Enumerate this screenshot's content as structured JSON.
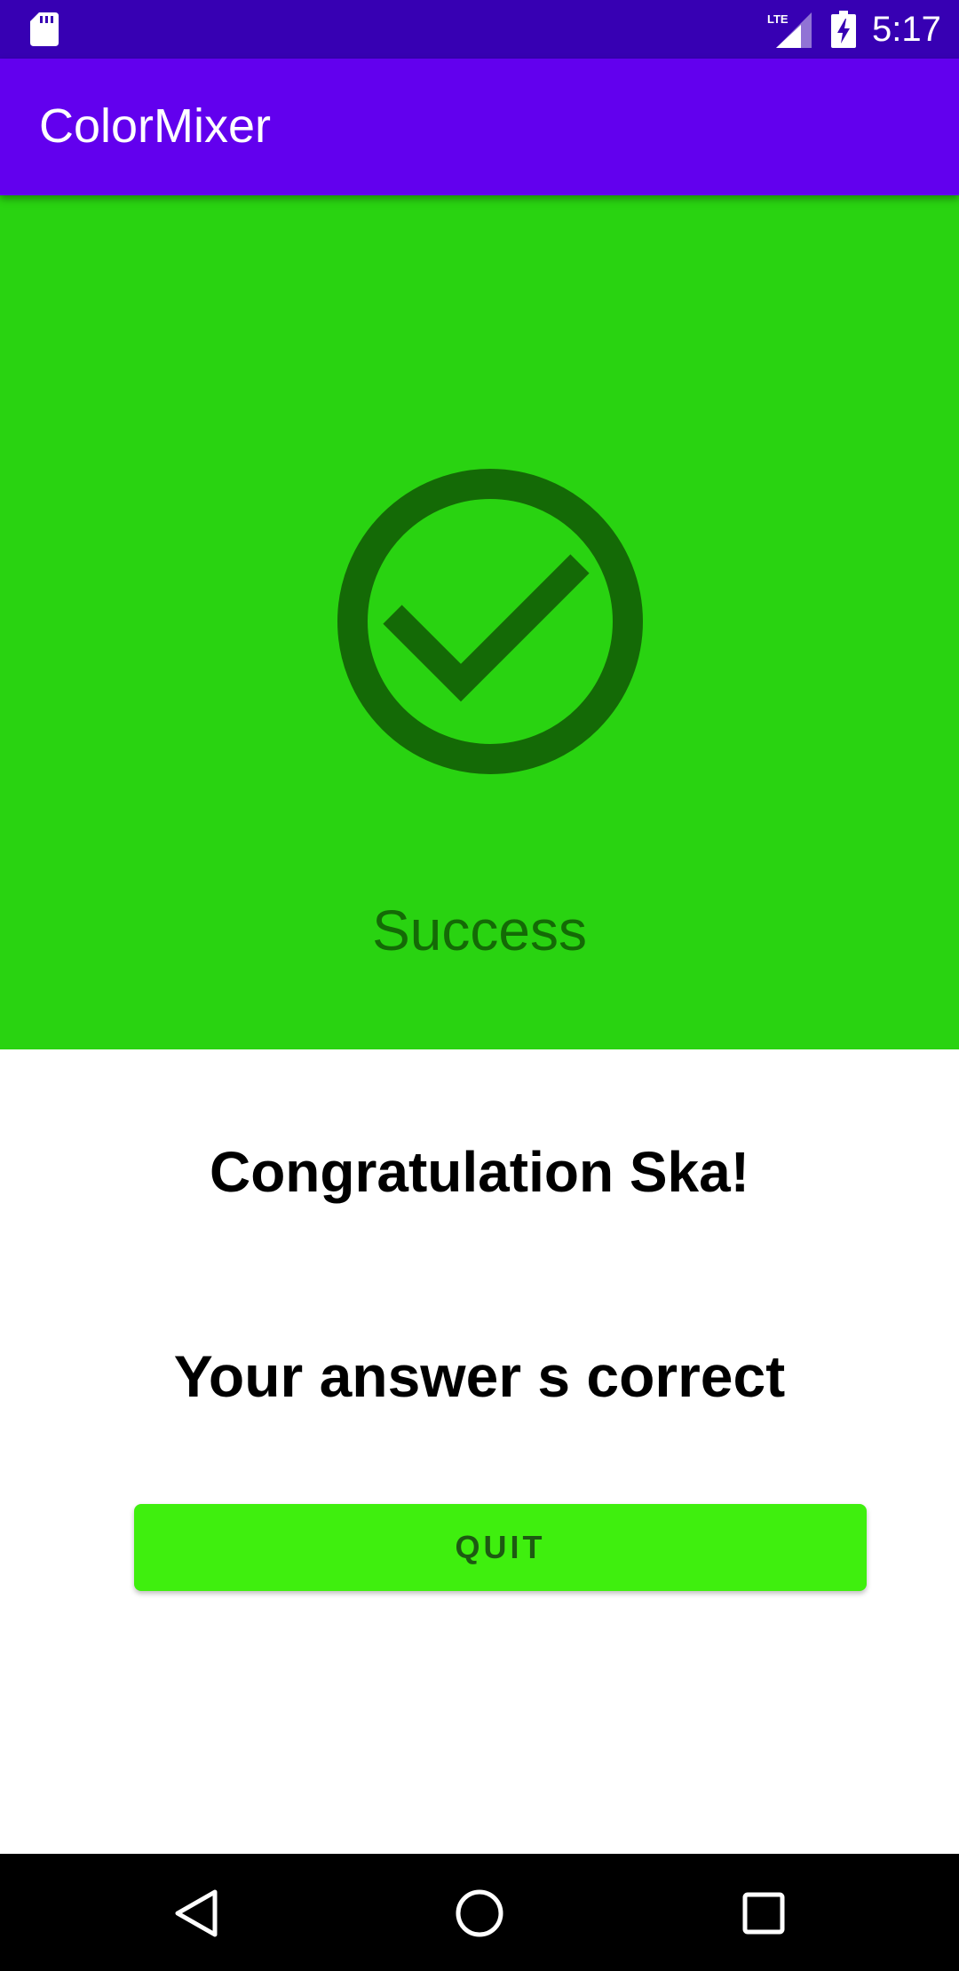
{
  "status_bar": {
    "network_label": "LTE",
    "time": "5:17"
  },
  "app_bar": {
    "title": "ColorMixer"
  },
  "result": {
    "status_label": "Success",
    "icon": "check-circle-icon",
    "panel_color": "#29d311",
    "icon_color": "#146a06"
  },
  "messages": {
    "congratulation": "Congratulation Ska!",
    "answer": "Your answer s correct"
  },
  "actions": {
    "quit_label": "QUIT",
    "quit_color": "#3fef0e"
  },
  "nav_bar": {
    "back_icon": "back-triangle-icon",
    "home_icon": "home-circle-icon",
    "recents_icon": "recents-square-icon"
  },
  "colors": {
    "status_bar": "#3700b3",
    "app_bar": "#6200ee"
  }
}
